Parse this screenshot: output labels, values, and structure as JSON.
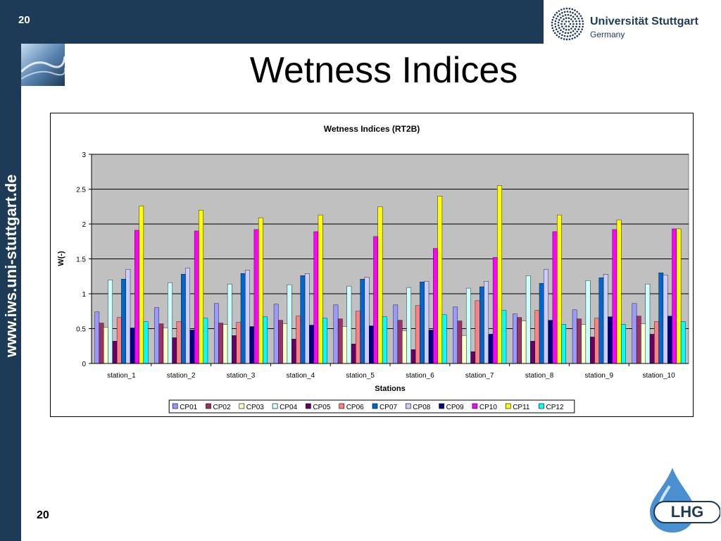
{
  "slide": {
    "page_number": "20",
    "title": "Wetness Indices",
    "side_url": "www.iws.uni-stuttgart.de",
    "university": "Universität Stuttgart",
    "country": "Germany",
    "logo_text": "LHG"
  },
  "colors": {
    "navy": "#1d3a56",
    "plot_bg": "#c0c0c0"
  },
  "chart_data": {
    "type": "bar",
    "title": "Wetness Indices (RT2B)",
    "xlabel": "Stations",
    "ylabel": "W(-)",
    "ylim": [
      0,
      3
    ],
    "yticks": [
      "0",
      "0.5",
      "1",
      "1.5",
      "2",
      "2.5",
      "3"
    ],
    "grid": true,
    "legend_position": "bottom",
    "categories": [
      "station_1",
      "station_2",
      "station_3",
      "station_4",
      "station_5",
      "station_6",
      "station_7",
      "station_8",
      "station_9",
      "station_10"
    ],
    "series": [
      {
        "name": "CP01",
        "color": "#9999ff",
        "values": [
          0.74,
          0.8,
          0.86,
          0.85,
          0.84,
          0.84,
          0.81,
          0.71,
          0.77,
          0.86
        ]
      },
      {
        "name": "CP02",
        "color": "#993366",
        "values": [
          0.58,
          0.57,
          0.58,
          0.62,
          0.64,
          0.62,
          0.61,
          0.66,
          0.64,
          0.68
        ]
      },
      {
        "name": "CP03",
        "color": "#ffffcc",
        "values": [
          0.52,
          0.51,
          0.56,
          0.57,
          0.53,
          0.47,
          0.4,
          0.61,
          0.56,
          0.57
        ]
      },
      {
        "name": "CP04",
        "color": "#ccffff",
        "values": [
          1.2,
          1.16,
          1.14,
          1.13,
          1.11,
          1.09,
          1.08,
          1.26,
          1.19,
          1.14
        ]
      },
      {
        "name": "CP05",
        "color": "#660066",
        "values": [
          0.32,
          0.37,
          0.4,
          0.35,
          0.28,
          0.2,
          0.17,
          0.32,
          0.38,
          0.42
        ]
      },
      {
        "name": "CP06",
        "color": "#ff8080",
        "values": [
          0.66,
          0.6,
          0.59,
          0.68,
          0.75,
          0.83,
          0.9,
          0.76,
          0.65,
          0.6
        ]
      },
      {
        "name": "CP07",
        "color": "#0066cc",
        "values": [
          1.21,
          1.28,
          1.29,
          1.26,
          1.21,
          1.17,
          1.1,
          1.15,
          1.23,
          1.3
        ]
      },
      {
        "name": "CP08",
        "color": "#ccccff",
        "values": [
          1.35,
          1.37,
          1.34,
          1.29,
          1.24,
          1.18,
          1.18,
          1.35,
          1.28,
          1.27
        ]
      },
      {
        "name": "CP09",
        "color": "#000080",
        "values": [
          0.51,
          0.48,
          0.53,
          0.55,
          0.54,
          0.48,
          0.42,
          0.62,
          0.67,
          0.68
        ]
      },
      {
        "name": "CP10",
        "color": "#ff00ff",
        "values": [
          1.91,
          1.9,
          1.92,
          1.89,
          1.82,
          1.65,
          1.52,
          1.89,
          1.92,
          1.93
        ]
      },
      {
        "name": "CP11",
        "color": "#ffff00",
        "values": [
          2.26,
          2.2,
          2.09,
          2.13,
          2.25,
          2.4,
          2.55,
          2.13,
          2.06,
          1.93
        ]
      },
      {
        "name": "CP12",
        "color": "#00ffff",
        "values": [
          0.6,
          0.65,
          0.67,
          0.65,
          0.67,
          0.7,
          0.76,
          0.56,
          0.56,
          0.6
        ]
      }
    ]
  }
}
